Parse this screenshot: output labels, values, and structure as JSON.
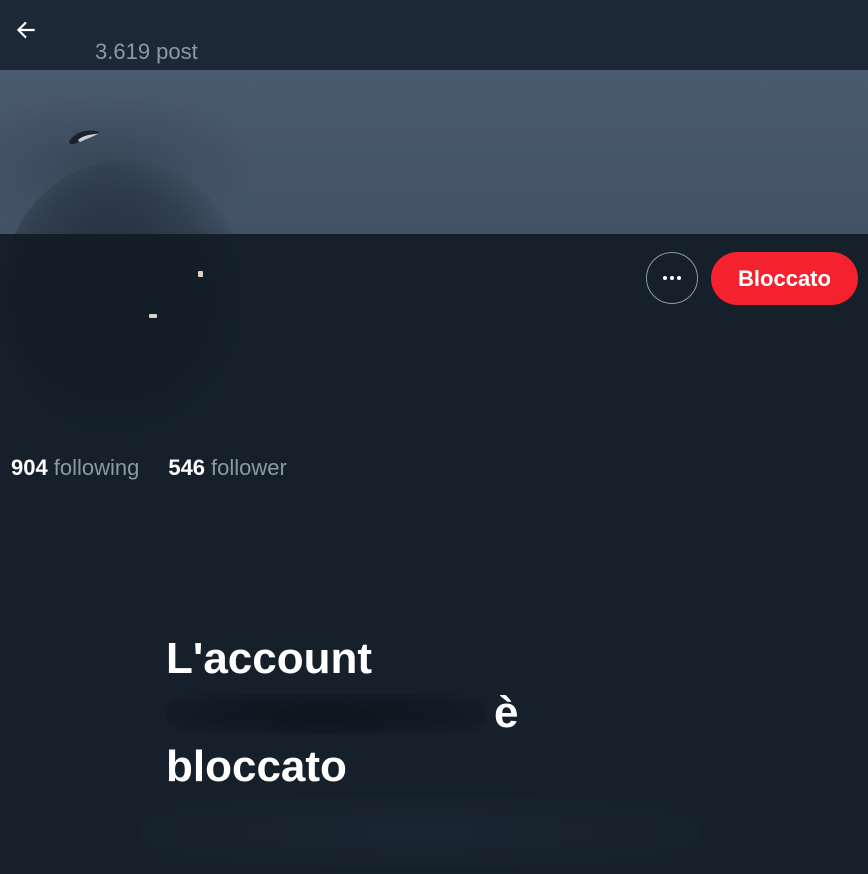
{
  "header": {
    "post_count": "3.619 post",
    "back_icon": "arrow-left-icon"
  },
  "banner": {
    "color": "#4a5a6e"
  },
  "actions": {
    "more_icon": "more-horizontal-icon",
    "blocked_label": "Bloccato",
    "blocked_color": "#f4212e"
  },
  "stats": {
    "following_count": "904",
    "following_label": "following",
    "follower_count": "546",
    "follower_label": "follower"
  },
  "blocked_message": {
    "line1": "L'account",
    "line2_suffix": "è",
    "line3": "bloccato"
  },
  "colors": {
    "background": "#15202b",
    "topbar": "#1c2835",
    "secondary_text": "#8b98a5"
  }
}
